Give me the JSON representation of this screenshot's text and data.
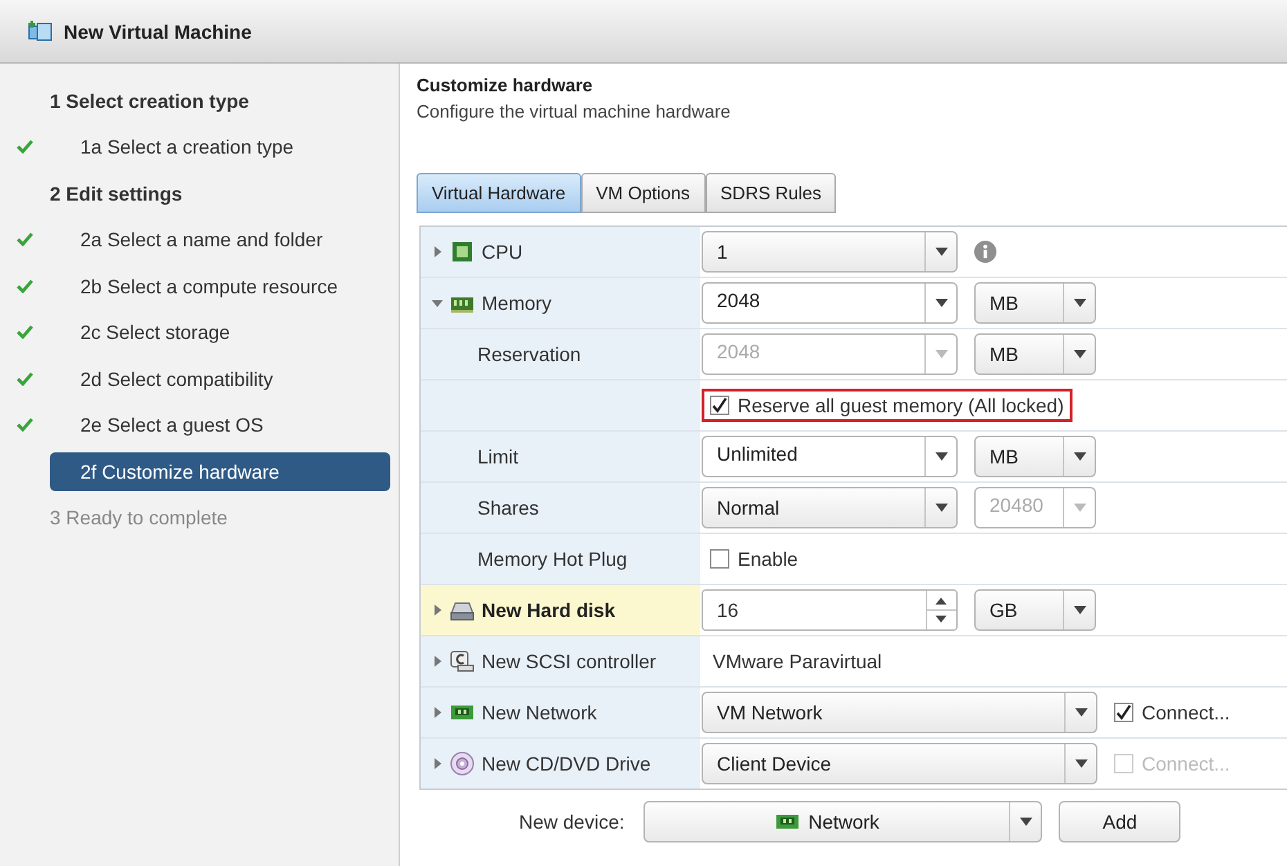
{
  "window": {
    "title": "New Virtual Machine"
  },
  "steps": [
    {
      "label": "1 Select creation type",
      "disabled": false,
      "children": [
        {
          "label": "1a Select a creation type",
          "done": true,
          "selected": false
        }
      ]
    },
    {
      "label": "2 Edit settings",
      "disabled": false,
      "children": [
        {
          "label": "2a Select a name and folder",
          "done": true,
          "selected": false
        },
        {
          "label": "2b Select a compute resource",
          "done": true,
          "selected": false
        },
        {
          "label": "2c Select storage",
          "done": true,
          "selected": false
        },
        {
          "label": "2d Select compatibility",
          "done": true,
          "selected": false
        },
        {
          "label": "2e Select a guest OS",
          "done": true,
          "selected": false
        },
        {
          "label": "2f Customize hardware",
          "done": false,
          "selected": true
        }
      ]
    },
    {
      "label": "3 Ready to complete",
      "disabled": true
    }
  ],
  "page": {
    "title": "Customize hardware",
    "subtitle": "Configure the virtual machine hardware"
  },
  "tabs": [
    {
      "label": "Virtual Hardware",
      "selected": true
    },
    {
      "label": "VM Options",
      "selected": false
    },
    {
      "label": "SDRS Rules",
      "selected": false
    }
  ],
  "rows": [
    {
      "kind": "cpu",
      "label": "CPU",
      "expanded": false,
      "highlighted": false,
      "controls": [
        {
          "kind": "select",
          "value": "1",
          "editable": false,
          "disabled": false
        },
        {
          "kind": "info"
        }
      ]
    },
    {
      "kind": "memory",
      "label": "Memory",
      "expanded": true,
      "highlighted": false,
      "controls": [
        {
          "kind": "select",
          "value": "2048",
          "editable": true,
          "disabled": false
        },
        {
          "kind": "select",
          "value": "MB",
          "editable": false,
          "disabled": false
        }
      ]
    },
    {
      "kind": "setting",
      "label": "Reservation",
      "highlighted": false,
      "controls": [
        {
          "kind": "select",
          "value": "2048",
          "editable": true,
          "disabled": true
        },
        {
          "kind": "select",
          "value": "MB",
          "editable": false,
          "disabled": false
        }
      ]
    },
    {
      "kind": "setting",
      "highlighted": false,
      "controls": [
        {
          "kind": "checkbox",
          "label": "Reserve all guest memory (All locked)",
          "checked": true,
          "disabled": false,
          "outlined": true
        }
      ]
    },
    {
      "kind": "setting",
      "label": "Limit",
      "highlighted": false,
      "controls": [
        {
          "kind": "select",
          "value": "Unlimited",
          "editable": true,
          "disabled": false
        },
        {
          "kind": "select",
          "value": "MB",
          "editable": false,
          "disabled": false
        }
      ]
    },
    {
      "kind": "setting",
      "label": "Shares",
      "highlighted": false,
      "controls": [
        {
          "kind": "select",
          "value": "Normal",
          "editable": false,
          "disabled": false
        },
        {
          "kind": "select",
          "value": "20480",
          "editable": true,
          "disabled": true
        }
      ]
    },
    {
      "kind": "setting",
      "label": "Memory Hot Plug",
      "highlighted": false,
      "controls": [
        {
          "kind": "checkbox",
          "label": "Enable",
          "checked": false,
          "disabled": false,
          "outlined": false
        }
      ]
    },
    {
      "kind": "disk",
      "label": "New Hard disk",
      "expanded": false,
      "highlighted": true,
      "controls": [
        {
          "kind": "spinner",
          "value": "16"
        },
        {
          "kind": "select",
          "value": "GB",
          "editable": false,
          "disabled": false
        }
      ]
    },
    {
      "kind": "scsi",
      "label": "New SCSI controller",
      "expanded": false,
      "highlighted": false,
      "controls": [
        {
          "kind": "text",
          "value": "VMware Paravirtual"
        }
      ]
    },
    {
      "kind": "network",
      "label": "New Network",
      "expanded": false,
      "highlighted": false,
      "controls": [
        {
          "kind": "wide-select",
          "value": "VM Network",
          "editable": false,
          "disabled": false
        },
        {
          "kind": "checkbox",
          "label": "Connect...",
          "checked": true,
          "disabled": false,
          "outlined": false
        }
      ]
    },
    {
      "kind": "cdrom",
      "label": "New CD/DVD Drive",
      "expanded": false,
      "highlighted": false,
      "controls": [
        {
          "kind": "wide-select",
          "value": "Client Device",
          "editable": false,
          "disabled": false
        },
        {
          "kind": "checkbox",
          "label": "Connect...",
          "checked": false,
          "disabled": true,
          "outlined": false
        }
      ]
    }
  ],
  "new_device": {
    "label": "New device:",
    "value": "Network",
    "button": "Add"
  }
}
